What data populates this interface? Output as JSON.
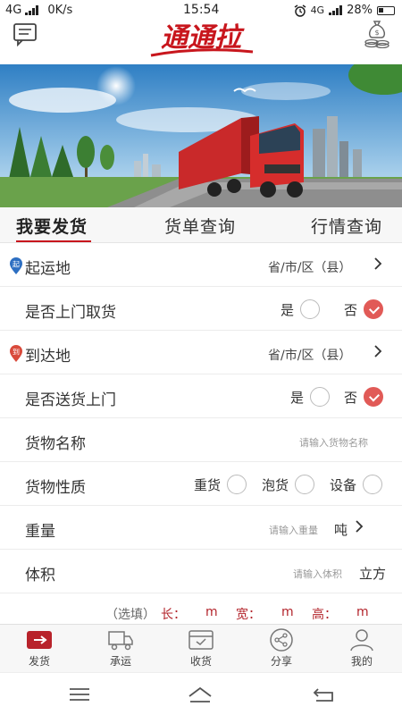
{
  "status_bar": {
    "network_left": "4G",
    "speed": "0K/s",
    "time": "15:54",
    "network_right": "4G",
    "battery": "28%"
  },
  "header": {
    "logo_text": "通通拉",
    "brand_color": "#c8161d"
  },
  "tabs": [
    {
      "label": "我要发货",
      "active": true
    },
    {
      "label": "货单查询",
      "active": false
    },
    {
      "label": "行情查询",
      "active": false
    }
  ],
  "form": {
    "origin": {
      "badge": "起",
      "label": "起运地",
      "value": "省/市/区（县）"
    },
    "pickup": {
      "label": "是否上门取货",
      "yes": "是",
      "no": "否",
      "selected": "no"
    },
    "destination": {
      "badge": "到",
      "label": "到达地",
      "value": "省/市/区（县）"
    },
    "delivery": {
      "label": "是否送货上门",
      "yes": "是",
      "no": "否",
      "selected": "no"
    },
    "cargo_name": {
      "label": "货物名称",
      "placeholder": "请输入货物名称"
    },
    "cargo_type": {
      "label": "货物性质",
      "options": [
        "重货",
        "泡货",
        "设备"
      ]
    },
    "weight": {
      "label": "重量",
      "placeholder": "请输入重量",
      "unit": "吨"
    },
    "volume": {
      "label": "体积",
      "placeholder": "请输入体积",
      "unit": "立方"
    },
    "dimensions": {
      "optional": "（选填）",
      "length": "长：",
      "width": "宽：",
      "height": "高：",
      "unit": "m"
    }
  },
  "bottom_nav": [
    {
      "label": "发货",
      "icon": "truck-send-icon",
      "active": true
    },
    {
      "label": "承运",
      "icon": "truck-carry-icon",
      "active": false
    },
    {
      "label": "收货",
      "icon": "receive-box-icon",
      "active": false
    },
    {
      "label": "分享",
      "icon": "share-icon",
      "active": false
    },
    {
      "label": "我的",
      "icon": "person-icon",
      "active": false
    }
  ],
  "colors": {
    "accent": "#c8161d",
    "checked": "#e15a57"
  }
}
